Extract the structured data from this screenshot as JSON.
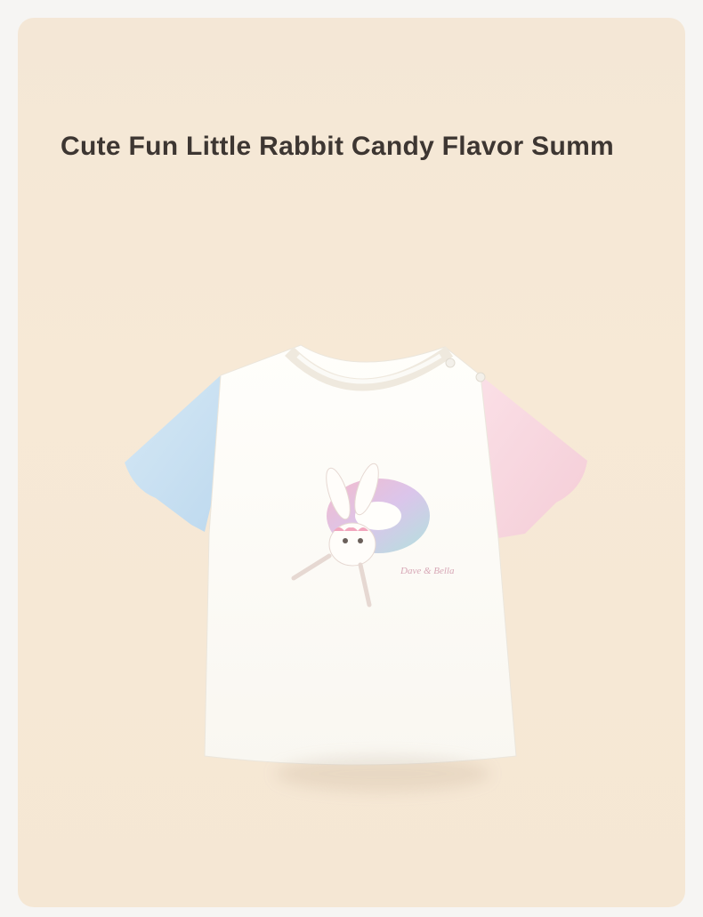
{
  "title": "Cute Fun Little Rabbit Candy Flavor Summ",
  "product": {
    "image": "kids-tshirt-image",
    "colors": {
      "background": "#f6f5f3",
      "card": "#f4e7d6",
      "shirt_body": "#fdfcf8",
      "left_sleeve": "#c9e1f2",
      "right_sleeve": "#f7d6df",
      "title_text": "#3d3632"
    },
    "print_text": "Dave & Bella"
  }
}
